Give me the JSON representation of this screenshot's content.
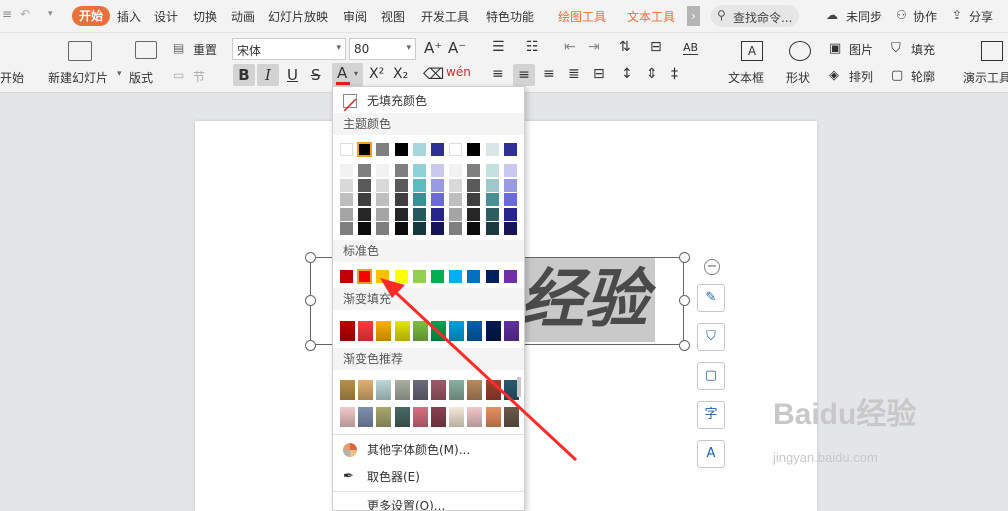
{
  "menubar": {
    "tabs": [
      "开始",
      "插入",
      "设计",
      "切换",
      "动画",
      "幻灯片放映",
      "审阅",
      "视图",
      "开发工具",
      "特色功能",
      "绘图工具",
      "文本工具"
    ],
    "search": "查找命令...",
    "sync": "未同步",
    "collab": "协作",
    "share": "分享"
  },
  "ribbon": {
    "start_label": "开始",
    "new_slide": "新建幻灯片",
    "layout": "版式",
    "section": "节",
    "reset": "重置",
    "font_name": "宋体",
    "font_size": "80",
    "textbox": "文本框",
    "shape": "形状",
    "picture": "图片",
    "arrange": "排列",
    "fill": "填充",
    "outline": "轮廓",
    "present": "演示工具"
  },
  "slide": {
    "wordart": "经验"
  },
  "color_menu": {
    "no_fill": "无填充颜色",
    "theme_colors": "主题颜色",
    "standard_colors": "标准色",
    "gradient_fill": "渐变填充",
    "gradient_recommend": "渐变色推荐",
    "more_colors": "其他字体颜色(M)...",
    "eyedropper": "取色器(E)",
    "more_settings": "更多设置(O)...",
    "theme_row": [
      "#ffffff",
      "#000000",
      "#7f7f7f",
      "#000000",
      "#a8d6dd",
      "#2e3192",
      "#ffffff",
      "#000000",
      "#d8e6e8",
      "#2e3192"
    ],
    "theme_shades": [
      [
        "#f2f2f2",
        "#7f7f7f",
        "#f2f2f2",
        "#7f7f7f",
        "#8fd1d6",
        "#c9c9f0",
        "#f2f2f2",
        "#7f7f7f",
        "#c6dfe1",
        "#c9c9f0"
      ],
      [
        "#d9d9d9",
        "#595959",
        "#d9d9d9",
        "#595959",
        "#5fb9c1",
        "#9a9ae3",
        "#d9d9d9",
        "#595959",
        "#9fc8cc",
        "#9a9ae3"
      ],
      [
        "#bfbfbf",
        "#3f3f3f",
        "#bfbfbf",
        "#3f3f3f",
        "#3a8e96",
        "#6b6bd5",
        "#bfbfbf",
        "#3f3f3f",
        "#4a8f95",
        "#6b6bd5"
      ],
      [
        "#a5a5a5",
        "#262626",
        "#a5a5a5",
        "#262626",
        "#245a5f",
        "#25258a",
        "#a5a5a5",
        "#262626",
        "#2b5d61",
        "#25258a"
      ],
      [
        "#7f7f7f",
        "#0d0d0d",
        "#7f7f7f",
        "#0d0d0d",
        "#14393c",
        "#151557",
        "#7f7f7f",
        "#0d0d0d",
        "#1a3b3e",
        "#151557"
      ]
    ],
    "standard_row": [
      "#c00000",
      "#ff0000",
      "#ffc000",
      "#ffff00",
      "#92d050",
      "#00b050",
      "#00b0f0",
      "#0070c0",
      "#002060",
      "#7030a0"
    ],
    "gradient_row": [
      "#c00000",
      "#ff3b3b",
      "#ffb000",
      "#e5e500",
      "#7fc040",
      "#00a050",
      "#00a0e0",
      "#0060b0",
      "#001a50",
      "#6030a0"
    ],
    "recommend_row1": [
      "#b8924a",
      "#e0b070",
      "#bcd8d8",
      "#a8b0a0",
      "#6b6b7b",
      "#a05a6a",
      "#8ab0a0",
      "#b88a60",
      "#a04030",
      "#2a5a70"
    ],
    "recommend_row2": [
      "#f2c8c8",
      "#8090b0",
      "#a8a870",
      "#486860",
      "#d87080",
      "#8a4050",
      "#f4e8d8",
      "#f0c8c8",
      "#e89060",
      "#6a5a4a"
    ]
  },
  "watermark": {
    "brand": "Baidu经验",
    "url": "jingyan.baidu.com"
  }
}
